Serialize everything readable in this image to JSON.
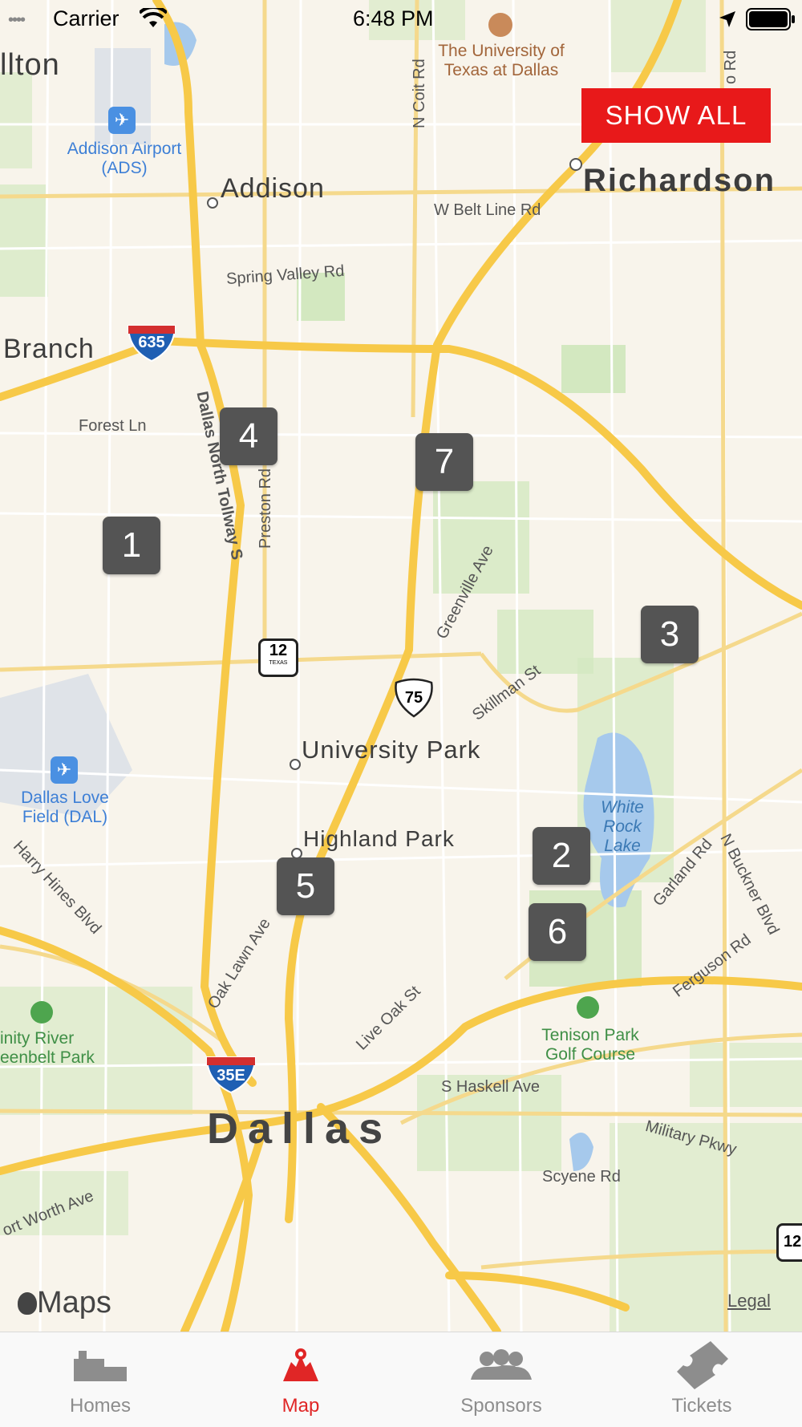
{
  "status_bar": {
    "carrier": "Carrier",
    "time": "6:48 PM"
  },
  "map": {
    "cities": {
      "carrollton_partial": "llton",
      "addison": "Addison",
      "richardson": "Richardson",
      "farmers_branch_partial": "Branch",
      "university_park": "University Park",
      "highland_park": "Highland Park",
      "dallas": "Dallas"
    },
    "pois": {
      "utd": "The University of Texas at Dallas",
      "addison_airport": "Addison Airport (ADS)",
      "love_field": "Dallas Love Field (DAL)",
      "trinity_river": "inity River eenbelt Park",
      "tenison": "Tenison Park Golf Course",
      "white_rock_lake": "White Rock Lake"
    },
    "streets": {
      "n_coit": "N Coit Rd",
      "w_belt_line": "W Belt Line Rd",
      "spring_valley": "Spring Valley Rd",
      "forest_ln": "Forest Ln",
      "dnt": "Dallas North Tollway S",
      "preston": "Preston Rd",
      "greenville": "Greenville Ave",
      "skillman": "Skillman St",
      "harry_hines": "Harry Hines Blvd",
      "oak_lawn": "Oak Lawn Ave",
      "live_oak": "Live Oak St",
      "s_haskell": "S Haskell Ave",
      "military": "Military Pkwy",
      "scyene": "Scyene Rd",
      "garland": "Garland Rd",
      "n_buckner": "N Buckner Blvd",
      "ferguson": "Ferguson Rd",
      "fort_worth": "ort Worth Ave",
      "top_right_rd": "o Rd"
    },
    "shields": {
      "i635": "635",
      "tx12": "12",
      "tx12_sub": "TEXAS",
      "us75": "75",
      "i35e": "35E",
      "tx12_edge": "12"
    },
    "markers": [
      "1",
      "2",
      "3",
      "4",
      "5",
      "6",
      "7"
    ],
    "attribution": {
      "logo_text": "Maps",
      "legal": "Legal"
    }
  },
  "show_all_label": "SHOW ALL",
  "colors": {
    "accent": "#e8191a",
    "marker_bg": "#545454",
    "highway": "#f7c948",
    "park": "#cfe6bb",
    "water": "#a6c9ec"
  },
  "tabs": [
    {
      "label": "Homes",
      "icon": "homes-icon",
      "active": false
    },
    {
      "label": "Map",
      "icon": "map-pin-icon",
      "active": true
    },
    {
      "label": "Sponsors",
      "icon": "sponsors-icon",
      "active": false
    },
    {
      "label": "Tickets",
      "icon": "tickets-icon",
      "active": false
    }
  ]
}
